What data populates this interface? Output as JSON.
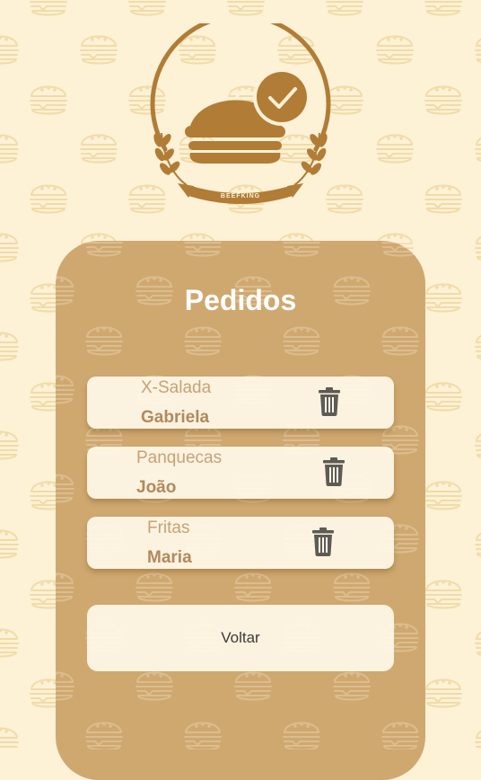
{
  "brand": {
    "logo_text": "BEEFKING"
  },
  "page": {
    "title": "Pedidos"
  },
  "orders": [
    {
      "item": "X-Salada",
      "customer": "Gabriela"
    },
    {
      "item": "Panquecas",
      "customer": "João"
    },
    {
      "item": "Fritas",
      "customer": "Maria"
    }
  ],
  "actions": {
    "back_label": "Voltar",
    "delete_icon": "trash-icon"
  },
  "colors": {
    "background": "#fdf1d6",
    "pattern_burger": "#f1dca7",
    "panel": "#cfa870",
    "brand_brown": "#b17c36",
    "card": "#fff8e8",
    "title_text": "#ffffff",
    "icon": "#5e5b56"
  }
}
